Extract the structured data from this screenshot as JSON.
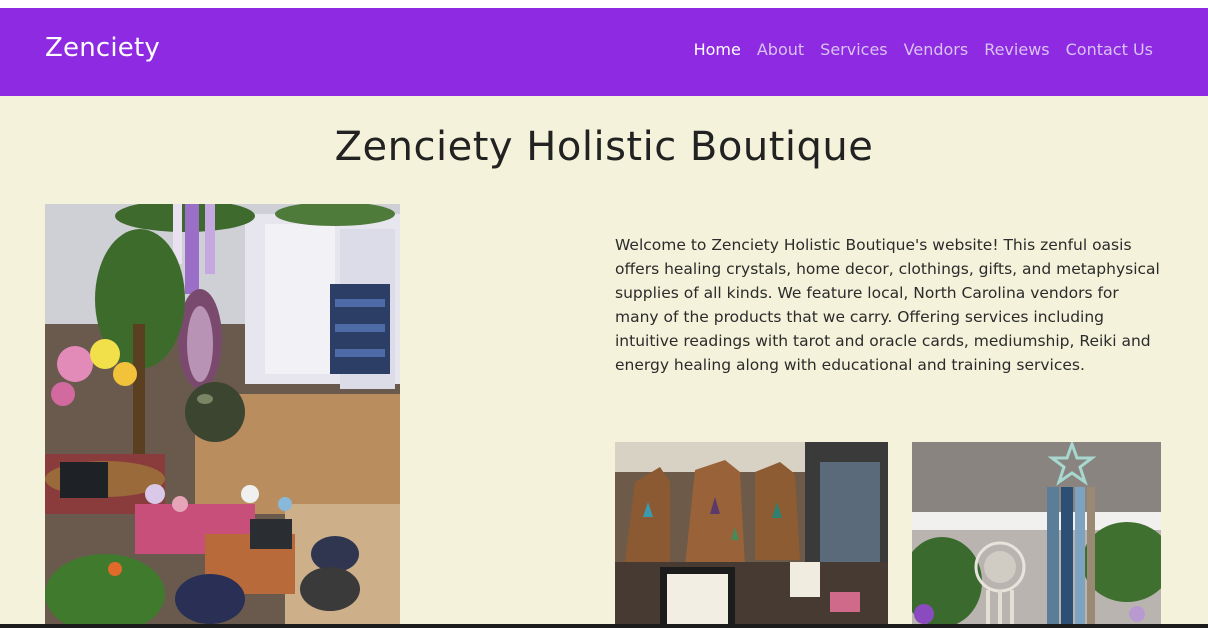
{
  "header": {
    "brand": "Zenciety",
    "nav": [
      "Home",
      "About",
      "Services",
      "Vendors",
      "Reviews",
      "Contact Us"
    ],
    "active_nav": "Home",
    "background": "#8e2ae2"
  },
  "main": {
    "title": "Zenciety Holistic Boutique",
    "intro": "Welcome to Zenciety Holistic Boutique's website! This zenful oasis offers healing crystals, home decor, clothings, gifts, and metaphysical supplies of all kinds. We feature local, North Carolina vendors for many of the products that we carry. Offering services including intuitive readings with tarot and oracle cards, mediumship, Reiki and energy healing along with educational and training services.",
    "background": "#f4f2da"
  }
}
